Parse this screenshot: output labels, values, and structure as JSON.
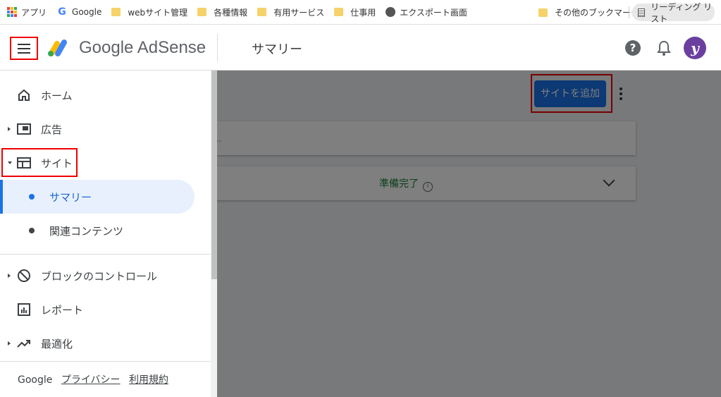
{
  "bookmarks": {
    "items": [
      "アプリ",
      "Google",
      "webサイト管理",
      "各種情報",
      "有用サービス",
      "仕事用",
      "エクスポート画面"
    ],
    "other": "その他のブックマーク",
    "reading_list": "リーディング リスト"
  },
  "header": {
    "brand": "Google AdSense",
    "page_title": "サマリー",
    "help_glyph": "?",
    "avatar_letter": "y"
  },
  "main": {
    "add_site": "サイトを追加",
    "search_placeholder": "...",
    "status": "準備完了",
    "info_glyph": "i"
  },
  "nav": {
    "home": "ホーム",
    "ads": "広告",
    "sites": "サイト",
    "summary": "サマリー",
    "related": "関連コンテンツ",
    "block": "ブロックのコントロール",
    "reports": "レポート",
    "optimize": "最適化"
  },
  "footer": {
    "google": "Google",
    "privacy": "プライバシー",
    "terms": "利用規約"
  },
  "colors": {
    "accent": "#1a73e8",
    "status_green": "#188038",
    "highlight_box": "#e00000",
    "avatar": "#6b3fa0"
  },
  "icons": [
    "apps-icon",
    "google-icon",
    "folder-icon",
    "globe-icon",
    "reading-list-icon",
    "menu-icon",
    "adsense-logo",
    "help-icon",
    "bell-icon",
    "avatar",
    "home-icon",
    "ads-icon",
    "sites-icon",
    "block-icon",
    "report-icon",
    "trending-icon",
    "info-icon",
    "chevron-down-icon",
    "more-vert-icon"
  ]
}
